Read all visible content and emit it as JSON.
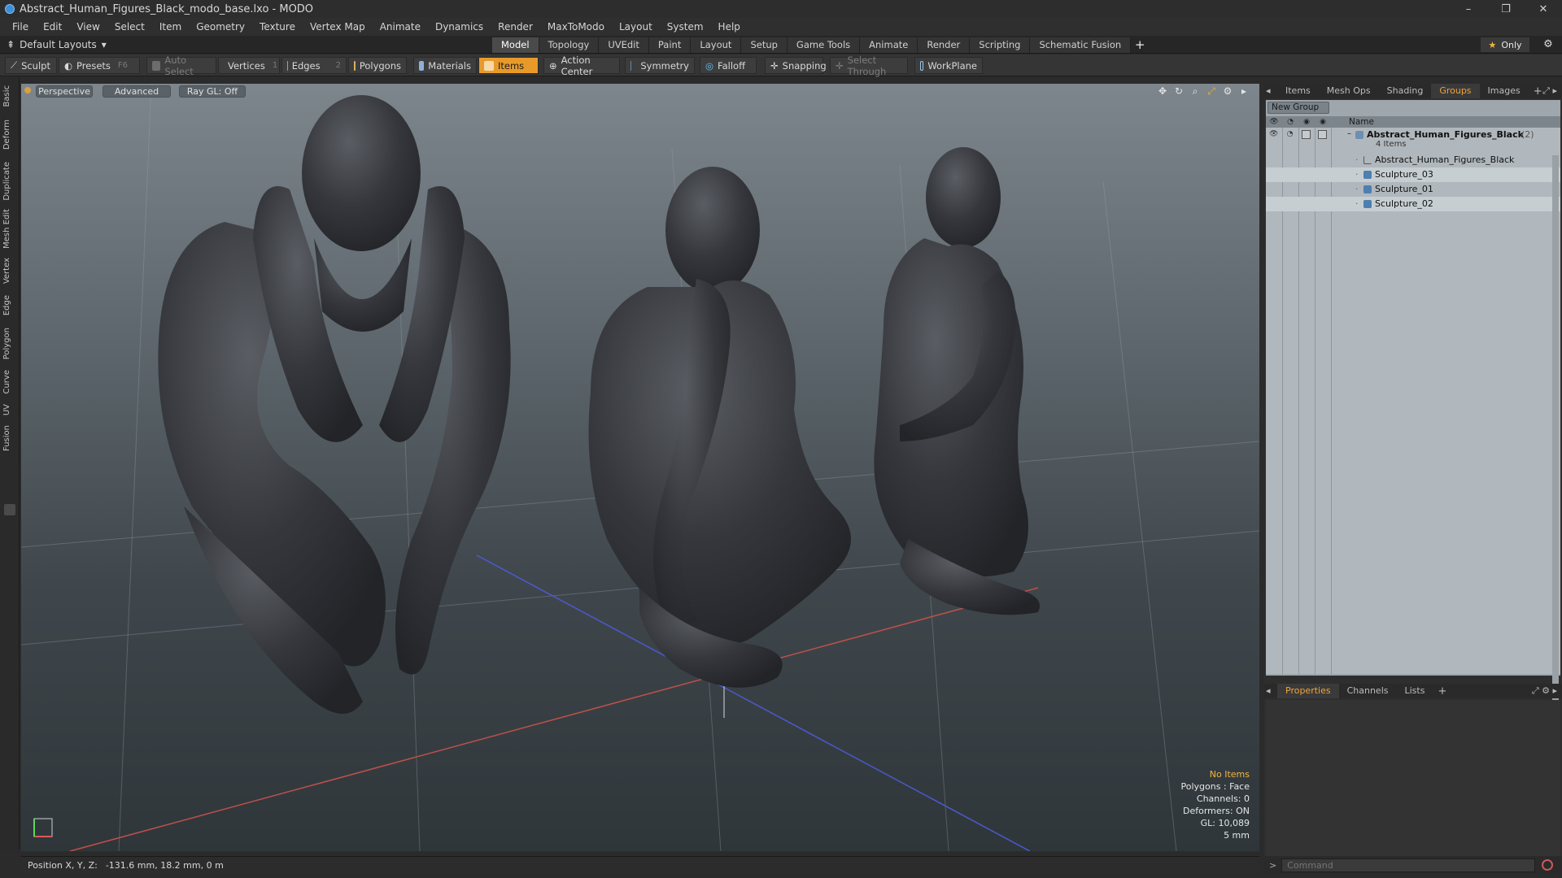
{
  "window": {
    "title": "Abstract_Human_Figures_Black_modo_base.lxo - MODO",
    "minimize": "–",
    "maximize": "❐",
    "close": "✕"
  },
  "menu": [
    "File",
    "Edit",
    "View",
    "Select",
    "Item",
    "Geometry",
    "Texture",
    "Vertex Map",
    "Animate",
    "Dynamics",
    "Render",
    "MaxToModo",
    "Layout",
    "System",
    "Help"
  ],
  "layout": {
    "selector": "Default Layouts",
    "tabs": [
      "Model",
      "Topology",
      "UVEdit",
      "Paint",
      "Layout",
      "Setup",
      "Game Tools",
      "Animate",
      "Render",
      "Scripting",
      "Schematic Fusion"
    ],
    "active_tab": "Model",
    "add": "+",
    "only_label": "Only"
  },
  "toolbar": {
    "sculpt": "Sculpt",
    "presets": "Presets",
    "presets_hotkey": "F6",
    "auto_select": "Auto Select",
    "vertices": "Vertices",
    "vertices_hotkey": "1",
    "edges": "Edges",
    "edges_hotkey": "2",
    "polygons": "Polygons",
    "materials": "Materials",
    "items": "Items",
    "action_center": "Action Center",
    "symmetry": "Symmetry",
    "falloff": "Falloff",
    "snapping": "Snapping",
    "select_through": "Select Through",
    "workplane": "WorkPlane"
  },
  "left_tabs": [
    "Basic",
    "Deform",
    "Duplicate",
    "Mesh Edit",
    "Vertex",
    "Edge",
    "Polygon",
    "Curve",
    "UV",
    "Fusion"
  ],
  "viewport": {
    "perspective": "Perspective",
    "advanced": "Advanced",
    "raygl": "Ray GL: Off",
    "info": {
      "no_items": "No Items",
      "polygons": "Polygons : Face",
      "channels": "Channels: 0",
      "deformers": "Deformers: ON",
      "gl": "GL: 10,089",
      "scale": "5 mm"
    }
  },
  "status": {
    "position_label": "Position X, Y, Z:",
    "position_value": "-131.6 mm, 18.2 mm, 0 m"
  },
  "right_panel": {
    "tabs": [
      "Items",
      "Mesh Ops",
      "Shading",
      "Groups",
      "Images"
    ],
    "active_tab": "Groups",
    "add": "+",
    "new_group": "New Group",
    "name_header": "Name",
    "group": {
      "name": "Abstract_Human_Figures_Black",
      "count": "(2)",
      "sub": "4 Items"
    },
    "items": [
      "Abstract_Human_Figures_Black",
      "Sculpture_03",
      "Sculpture_01",
      "Sculpture_02"
    ],
    "bottom_tabs": [
      "Properties",
      "Channels",
      "Lists"
    ],
    "bottom_active": "Properties",
    "command_placeholder": "Command",
    "command_prompt": ">"
  },
  "colors": {
    "accent": "#e79a2a",
    "active_tab_text": "#f0a33c",
    "info_highlight": "#f3b63e"
  }
}
